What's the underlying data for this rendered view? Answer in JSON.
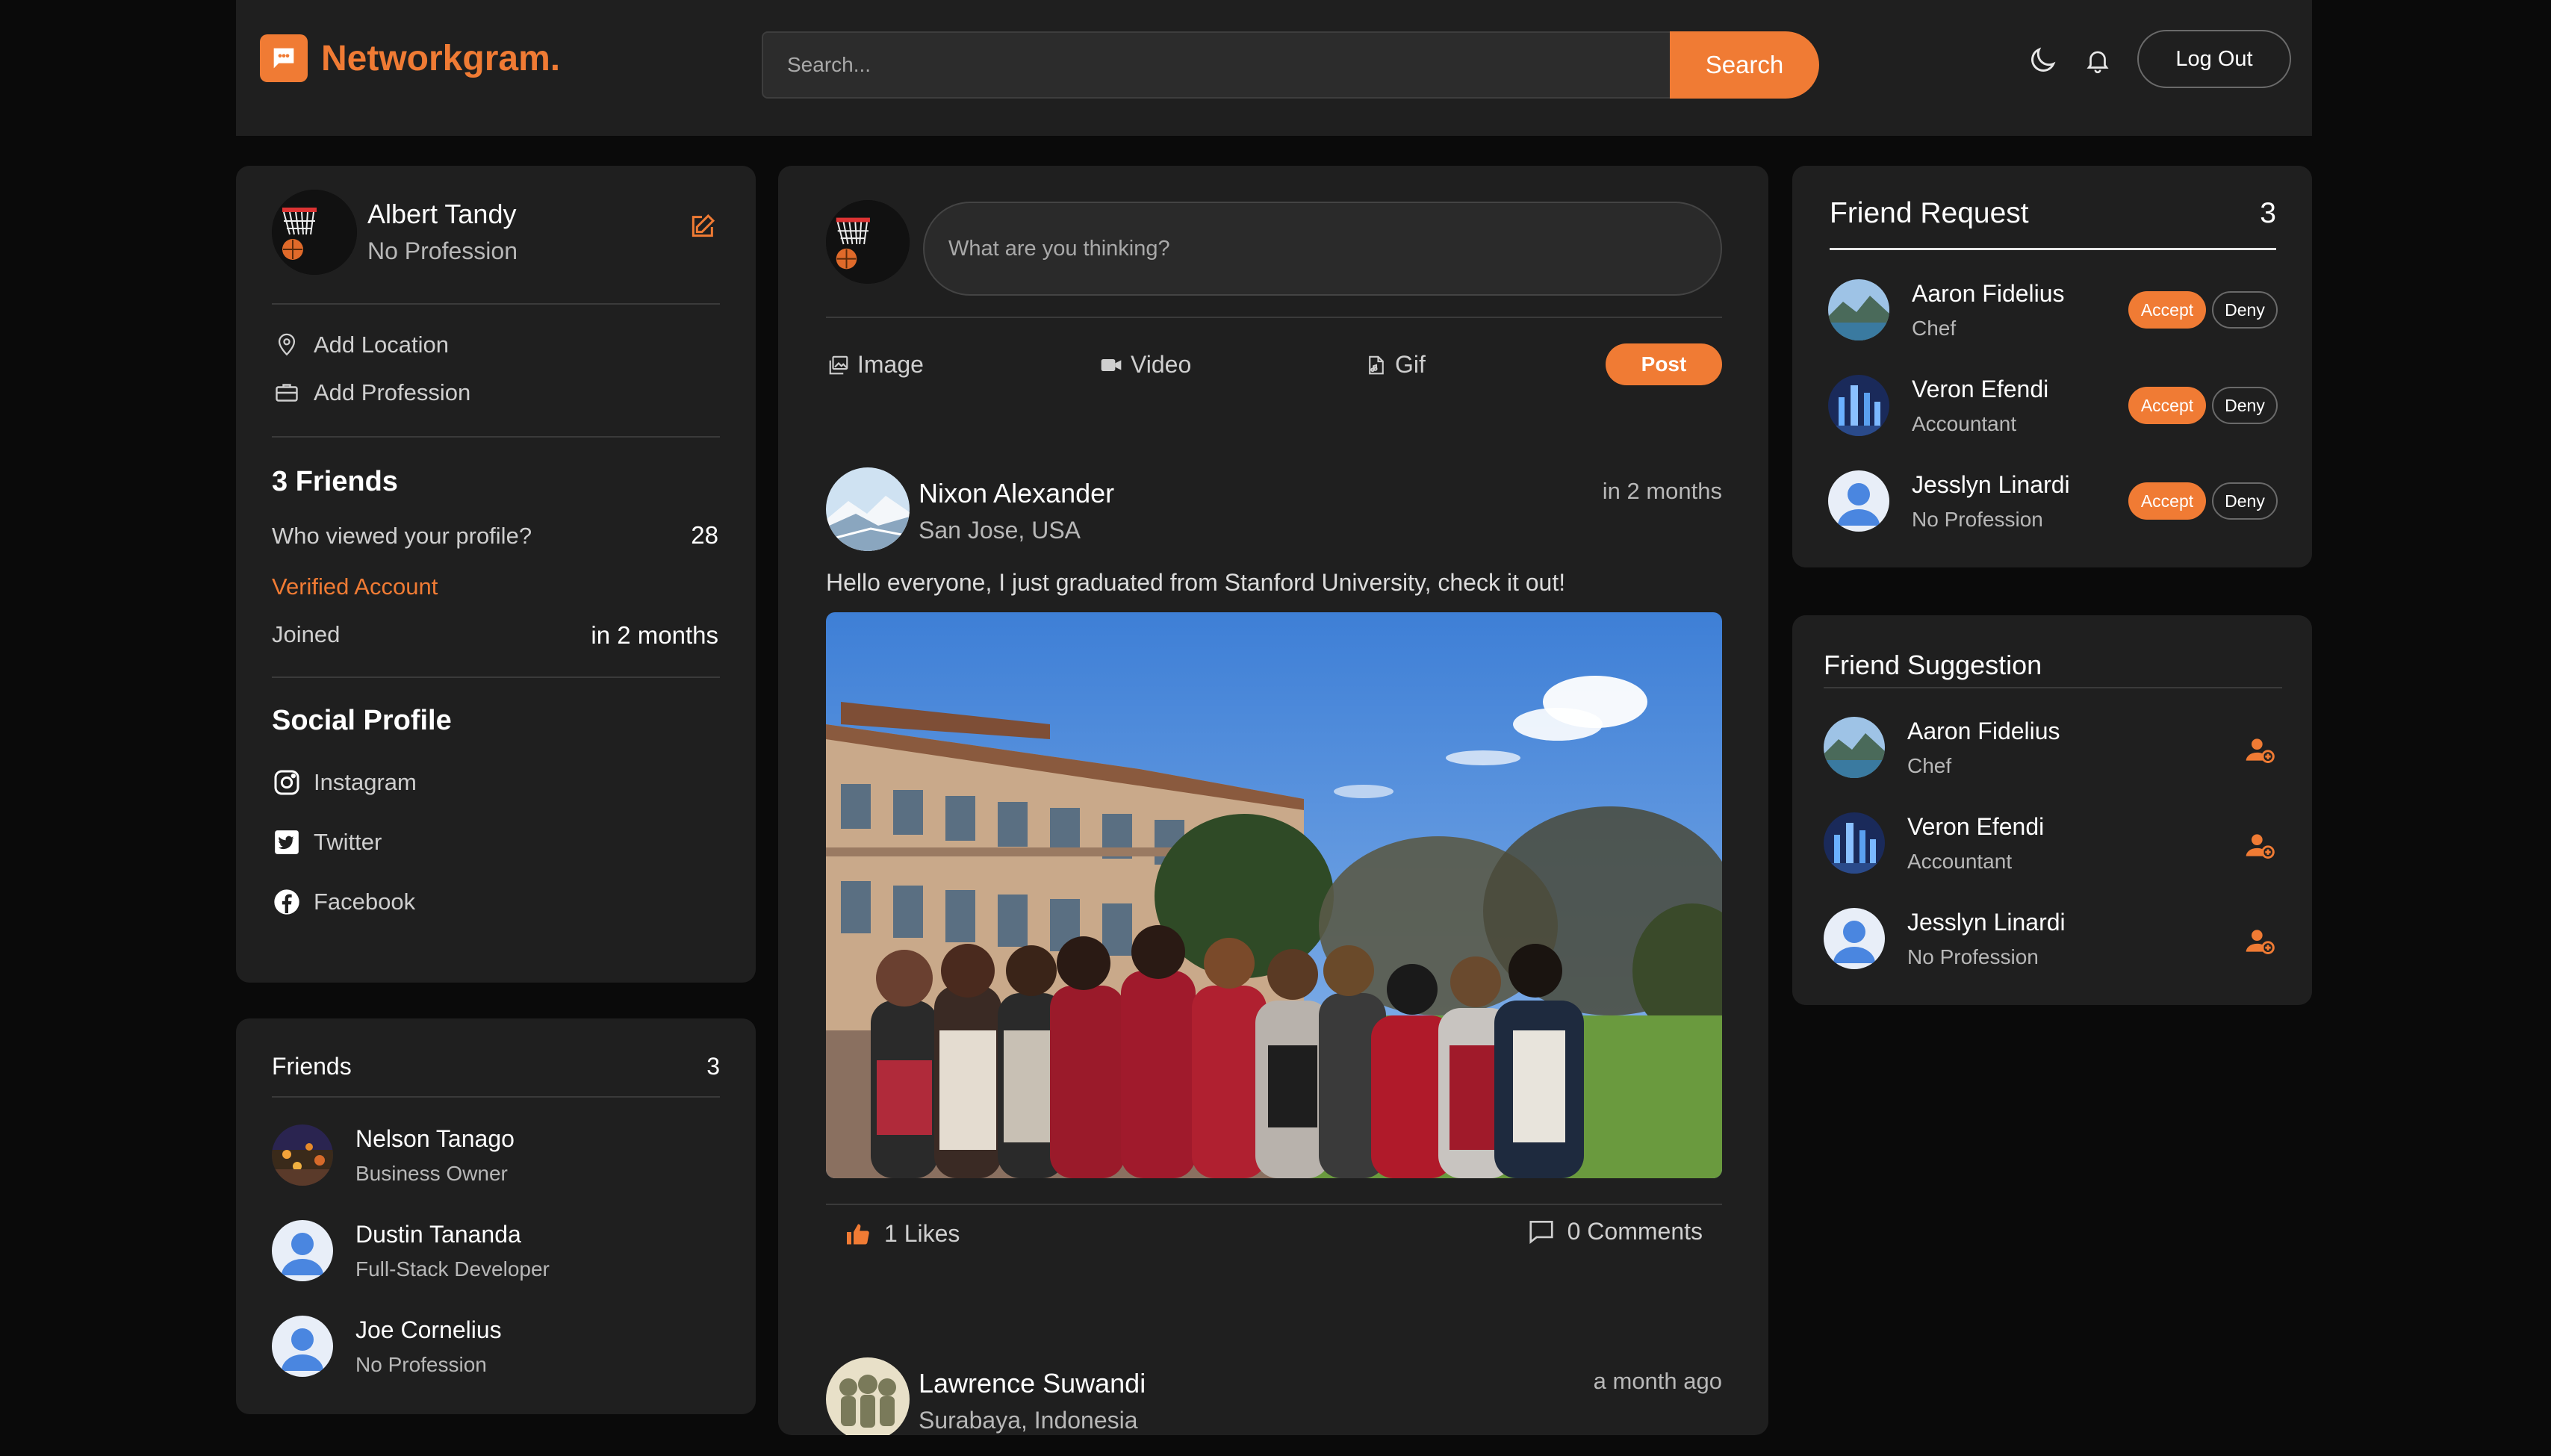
{
  "header": {
    "logo_text": "Networkgram.",
    "search_placeholder": "Search...",
    "search_button": "Search",
    "logout_button": "Log Out"
  },
  "profile": {
    "name": "Albert Tandy",
    "profession": "No Profession",
    "add_location": "Add Location",
    "add_profession": "Add Profession",
    "friends_heading": "3 Friends",
    "viewed_label": "Who viewed your profile?",
    "viewed_count": "28",
    "verified": "Verified Account",
    "joined_label": "Joined",
    "joined_value": "in 2 months",
    "social_heading": "Social Profile",
    "social": [
      "Instagram",
      "Twitter",
      "Facebook"
    ]
  },
  "friends": {
    "title": "Friends",
    "count": "3",
    "items": [
      {
        "name": "Nelson Tanago",
        "profession": "Business Owner"
      },
      {
        "name": "Dustin Tananda",
        "profession": "Full-Stack Developer"
      },
      {
        "name": "Joe Cornelius",
        "profession": "No Profession"
      }
    ]
  },
  "compose": {
    "placeholder": "What are you thinking?",
    "image": "Image",
    "video": "Video",
    "gif": "Gif",
    "post": "Post"
  },
  "posts": [
    {
      "author": "Nixon Alexander",
      "location": "San Jose, USA",
      "time": "in 2 months",
      "text": "Hello everyone, I just graduated from Stanford University, check it out!",
      "likes": "1 Likes",
      "comments": "0 Comments"
    },
    {
      "author": "Lawrence Suwandi",
      "location": "Surabaya, Indonesia",
      "time": "a month ago"
    }
  ],
  "friend_requests": {
    "title": "Friend Request",
    "count": "3",
    "accept": "Accept",
    "deny": "Deny",
    "items": [
      {
        "name": "Aaron Fidelius",
        "profession": "Chef"
      },
      {
        "name": "Veron Efendi",
        "profession": "Accountant"
      },
      {
        "name": "Jesslyn Linardi",
        "profession": "No Profession"
      }
    ]
  },
  "suggestions": {
    "title": "Friend Suggestion",
    "items": [
      {
        "name": "Aaron Fidelius",
        "profession": "Chef"
      },
      {
        "name": "Veron Efendi",
        "profession": "Accountant"
      },
      {
        "name": "Jesslyn Linardi",
        "profession": "No Profession"
      }
    ]
  },
  "colors": {
    "accent": "#f07b34",
    "background": "#0a0a0a",
    "card": "#1f1f1f"
  },
  "icons": [
    "chat-bubble-icon",
    "moon-icon",
    "bell-icon",
    "edit-icon",
    "location-pin-icon",
    "briefcase-icon",
    "instagram-icon",
    "twitter-icon",
    "facebook-icon",
    "image-icon",
    "video-icon",
    "gif-icon",
    "thumbs-up-icon",
    "comment-icon",
    "add-friend-icon"
  ]
}
